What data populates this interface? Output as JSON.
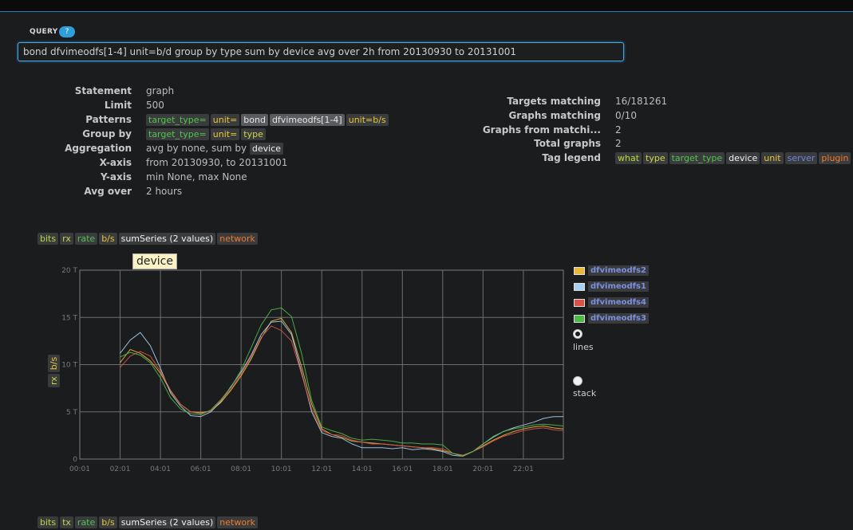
{
  "query": {
    "label": "QUERY",
    "help": "?",
    "value": "bond dfvimeodfs[1-4] unit=b/d group by type sum by device avg over 2h from 20130930 to 20131001"
  },
  "info_left": {
    "statement": {
      "key": "Statement",
      "value": "graph"
    },
    "limit": {
      "key": "Limit",
      "value": "500"
    },
    "patterns": {
      "key": "Patterns",
      "tags": [
        "target_type=",
        "unit=",
        "bond",
        "dfvimeodfs[1-4]",
        "unit=b/s"
      ]
    },
    "group_by": {
      "key": "Group by",
      "tags": [
        "target_type=",
        "unit=",
        "type"
      ]
    },
    "aggregation": {
      "key": "Aggregation",
      "value": "avg by none, sum by",
      "tag": "device"
    },
    "x_axis": {
      "key": "X-axis",
      "value": "from 20130930, to 20131001"
    },
    "y_axis": {
      "key": "Y-axis",
      "value": "min None, max None"
    },
    "avg_over": {
      "key": "Avg over",
      "value": "2 hours"
    }
  },
  "info_right": {
    "targets_matching": {
      "key": "Targets matching",
      "value": "16/181261"
    },
    "graphs_matching": {
      "key": "Graphs matching",
      "value": "0/10"
    },
    "graphs_from": {
      "key": "Graphs from matchi...",
      "value": "2"
    },
    "total_graphs": {
      "key": "Total graphs",
      "value": "2"
    },
    "tag_legend": {
      "key": "Tag legend",
      "tags": [
        "what",
        "type",
        "target_type",
        "device",
        "unit",
        "server",
        "plugin"
      ]
    }
  },
  "graph1_tags": [
    "bits",
    "rx",
    "rate",
    "b/s",
    "sumSeries (2 values)",
    "network"
  ],
  "graph2_tags": [
    "bits",
    "tx",
    "rate",
    "b/s",
    "sumSeries (2 values)",
    "network"
  ],
  "tooltip": "device",
  "radio": {
    "lines": "lines",
    "stack": "stack"
  },
  "colors": {
    "accent": "#2e9fd8",
    "background": "#1b1c1e"
  },
  "chart_data": {
    "type": "line",
    "ylabel_tags": [
      "rx",
      "b/s"
    ],
    "x_ticks": [
      "00:01",
      "02:01",
      "04:01",
      "06:01",
      "08:01",
      "10:01",
      "12:01",
      "14:01",
      "16:01",
      "18:01",
      "20:01",
      "22:01"
    ],
    "y_ticks": [
      "0",
      "5 T",
      "10 T",
      "15 T",
      "20 T"
    ],
    "ylim": [
      0,
      20
    ],
    "x": [
      "02:01",
      "02:31",
      "03:01",
      "03:31",
      "04:01",
      "04:31",
      "05:01",
      "05:31",
      "06:01",
      "06:31",
      "07:01",
      "07:31",
      "08:01",
      "08:31",
      "09:01",
      "09:31",
      "10:01",
      "10:31",
      "11:01",
      "11:31",
      "12:01",
      "12:31",
      "13:01",
      "13:31",
      "14:01",
      "14:31",
      "15:01",
      "15:31",
      "16:01",
      "16:31",
      "17:01",
      "17:31",
      "18:01",
      "18:31",
      "19:01",
      "19:31",
      "20:01",
      "20:31",
      "21:01",
      "21:31",
      "22:01",
      "22:31",
      "23:01",
      "23:31",
      "24:00"
    ],
    "series": [
      {
        "name": "dfvimeodfs2",
        "color": "#e8b83a",
        "values": [
          10.2,
          11.6,
          11.2,
          10.4,
          9.1,
          7.2,
          5.8,
          5.0,
          4.9,
          5.1,
          6.0,
          7.3,
          8.8,
          10.6,
          12.8,
          14.6,
          14.9,
          13.4,
          9.8,
          5.8,
          3.2,
          2.6,
          2.3,
          1.9,
          1.8,
          1.7,
          1.6,
          1.5,
          1.4,
          1.3,
          1.2,
          1.1,
          0.9,
          0.6,
          0.4,
          0.8,
          1.4,
          2.0,
          2.5,
          2.9,
          3.2,
          3.4,
          3.5,
          3.3,
          3.2
        ]
      },
      {
        "name": "dfvimeodfs1",
        "color": "#a9d0f0",
        "values": [
          11.2,
          12.6,
          13.4,
          12.0,
          9.6,
          7.0,
          5.6,
          4.6,
          4.5,
          5.0,
          6.1,
          7.7,
          9.2,
          11.0,
          13.2,
          14.5,
          14.6,
          13.2,
          9.2,
          5.0,
          2.8,
          2.4,
          2.2,
          1.6,
          1.2,
          1.2,
          1.2,
          1.1,
          1.2,
          1.0,
          1.1,
          1.0,
          0.8,
          0.4,
          0.3,
          0.8,
          1.6,
          2.3,
          2.9,
          3.3,
          3.6,
          3.9,
          4.3,
          4.5,
          4.5
        ]
      },
      {
        "name": "dfvimeodfs4",
        "color": "#d9524a",
        "values": [
          9.7,
          10.9,
          11.4,
          10.9,
          9.3,
          7.3,
          5.8,
          5.0,
          4.8,
          5.1,
          6.2,
          7.4,
          9.0,
          10.8,
          12.9,
          14.1,
          13.6,
          12.5,
          9.0,
          5.3,
          3.0,
          2.6,
          2.5,
          2.0,
          1.8,
          1.6,
          1.6,
          1.5,
          1.4,
          1.3,
          1.2,
          1.2,
          1.1,
          0.6,
          0.4,
          0.8,
          1.3,
          1.9,
          2.4,
          2.7,
          3.0,
          3.2,
          3.3,
          3.1,
          3.0
        ]
      },
      {
        "name": "dfvimeodfs3",
        "color": "#4fb84a",
        "values": [
          10.8,
          11.3,
          11.0,
          10.2,
          8.6,
          6.5,
          5.3,
          4.8,
          4.7,
          5.2,
          6.3,
          7.6,
          9.4,
          11.8,
          14.2,
          15.8,
          16.0,
          15.1,
          11.2,
          6.2,
          3.4,
          3.0,
          2.7,
          2.2,
          2.0,
          2.1,
          2.0,
          1.9,
          1.7,
          1.7,
          1.6,
          1.6,
          1.5,
          0.6,
          0.3,
          0.8,
          1.6,
          2.4,
          2.9,
          3.2,
          3.4,
          3.6,
          3.7,
          3.6,
          3.5
        ]
      }
    ]
  }
}
